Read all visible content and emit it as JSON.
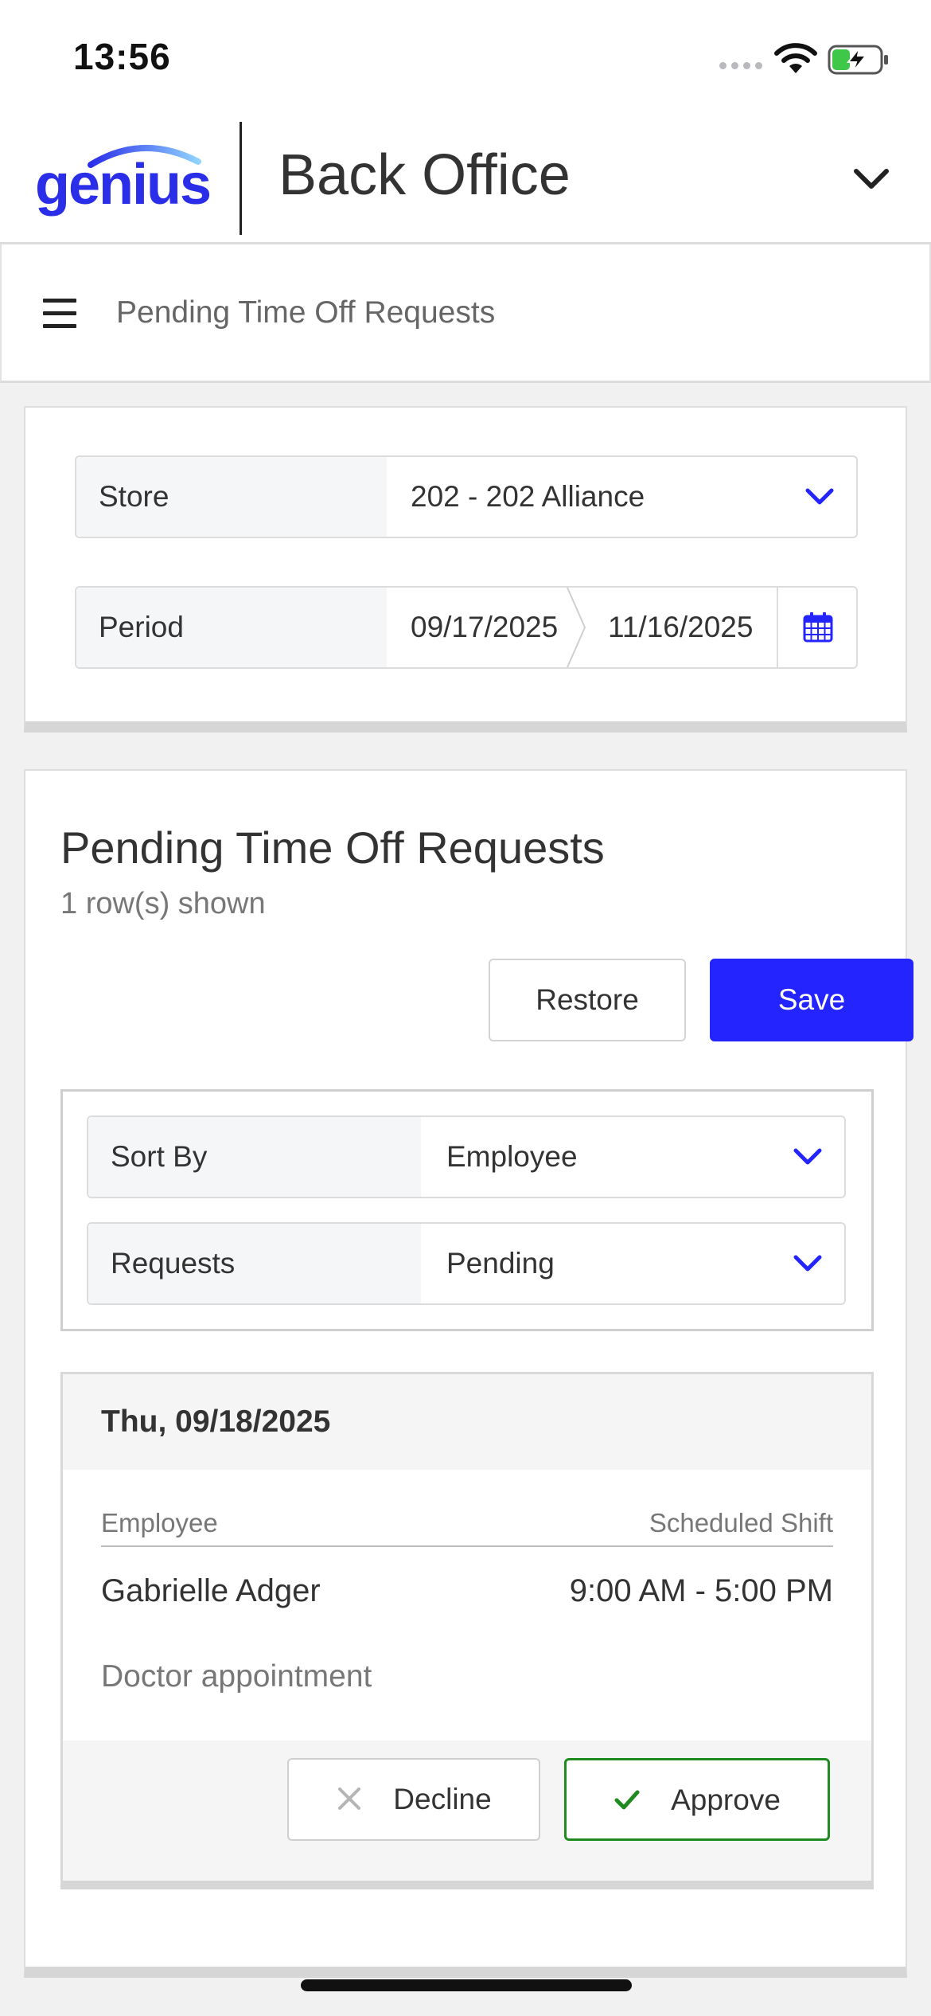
{
  "status_bar": {
    "time": "13:56"
  },
  "header": {
    "logo_text": "genius",
    "app_title": "Back Office"
  },
  "nav": {
    "page_title": "Pending Time Off Requests"
  },
  "filters": {
    "store": {
      "label": "Store",
      "value": "202 - 202 Alliance"
    },
    "period": {
      "label": "Period",
      "start": "09/17/2025",
      "end": "11/16/2025"
    }
  },
  "list": {
    "title": "Pending Time Off Requests",
    "row_count": "1 row(s) shown",
    "restore_label": "Restore",
    "save_label": "Save",
    "sort_by": {
      "label": "Sort By",
      "value": "Employee"
    },
    "requests_filter": {
      "label": "Requests",
      "value": "Pending"
    }
  },
  "requests": [
    {
      "date": "Thu, 09/18/2025",
      "employee_header": "Employee",
      "shift_header": "Scheduled Shift",
      "employee": "Gabrielle Adger",
      "shift": "9:00 AM - 5:00 PM",
      "reason": "Doctor appointment",
      "decline_label": "Decline",
      "approve_label": "Approve"
    }
  ],
  "colors": {
    "accent": "#2424ff",
    "logo": "#2a2ee8",
    "approve": "#1f8a1f",
    "battery": "#3fc74a"
  },
  "icons": [
    "wifi-icon",
    "battery-charging-icon",
    "chevron-down-icon",
    "hamburger-icon",
    "calendar-icon",
    "close-icon",
    "checkmark-icon"
  ]
}
